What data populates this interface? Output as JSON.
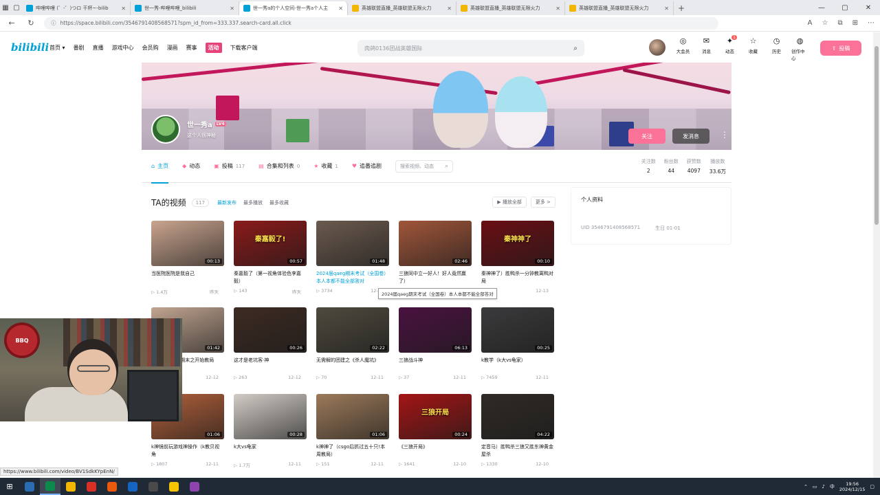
{
  "browser": {
    "tabs": [
      {
        "title": "哔哩哔哩 (゜-゜)つロ 干杯~-bilib",
        "color": "#00a1d6",
        "active": false
      },
      {
        "title": "世一秀-哔哩哔哩_bilibili",
        "color": "#00a1d6",
        "active": false
      },
      {
        "title": "世一秀a的个人空间-世一秀a个人主",
        "color": "#00a1d6",
        "active": true
      },
      {
        "title": "英雄联盟直播_英雄联盟无限火力",
        "color": "#f2b705",
        "active": false
      },
      {
        "title": "英雄联盟直播_英雄联盟无限火力",
        "color": "#f2b705",
        "active": false
      },
      {
        "title": "英雄联盟直播_英雄联盟无限火力",
        "color": "#f2b705",
        "active": false
      }
    ],
    "url": "https://space.bilibili.com/3546791408568571?spm_id_from=333.337.search-card.all.click",
    "status_url": "https://www.bilibili.com/video/BV1SdkKYpEnN/"
  },
  "header": {
    "logo": "bilibili",
    "nav": [
      "首页 ▾",
      "番剧",
      "直播",
      "游戏中心",
      "会员购",
      "漫画",
      "赛事",
      "活动",
      "下载客户端"
    ],
    "nav_highlight_index": 7,
    "search_placeholder": "肉鸽0136团战英雄国际",
    "icons": [
      {
        "label": "大会员",
        "icon": "◎"
      },
      {
        "label": "消息",
        "icon": "✉"
      },
      {
        "label": "动态",
        "icon": "✦",
        "badge": "1"
      },
      {
        "label": "收藏",
        "icon": "☆"
      },
      {
        "label": "历史",
        "icon": "◷"
      },
      {
        "label": "创作中心",
        "icon": "◍"
      }
    ],
    "upload_label": "投稿"
  },
  "profile": {
    "name": "世一秀a",
    "level": "LV4",
    "sign": "这个人很神秘",
    "follow_label": "关注",
    "message_label": "发消息"
  },
  "space_nav": {
    "items": [
      {
        "label": "主页",
        "icon": "⌂",
        "count": "",
        "active": true
      },
      {
        "label": "动态",
        "icon": "◆",
        "count": "",
        "active": false
      },
      {
        "label": "投稿",
        "icon": "▣",
        "count": "117",
        "active": false
      },
      {
        "label": "合集和列表",
        "icon": "▤",
        "count": "0",
        "active": false
      },
      {
        "label": "收藏",
        "icon": "★",
        "count": "1",
        "active": false
      },
      {
        "label": "追番追剧",
        "icon": "♥",
        "count": "",
        "active": false
      }
    ],
    "search_placeholder": "搜索视频、动态",
    "stats": [
      {
        "label": "关注数",
        "value": "2"
      },
      {
        "label": "粉丝数",
        "value": "44"
      },
      {
        "label": "获赞数",
        "value": "4097"
      },
      {
        "label": "播放数",
        "value": "33.6万"
      }
    ]
  },
  "videos_section": {
    "title": "TA的视频",
    "count": "117",
    "sorts": [
      {
        "label": "最新发布",
        "active": true
      },
      {
        "label": "最多播放",
        "active": false
      },
      {
        "label": "最多收藏",
        "active": false
      }
    ],
    "play_all": "▶ 播放全部",
    "more": "更多 >",
    "tooltip": "2024届qaeg期末考试（全国卷）本人本都不能全部答对",
    "videos": [
      {
        "title": "当医院医院是我自己",
        "duration": "00:13",
        "views": "1.4万",
        "date": "昨天",
        "thumb": "#c9a48e",
        "cap": "",
        "hover": false
      },
      {
        "title": "秦嘉毅了（第一视角体验色李嘉毅）",
        "duration": "00:57",
        "views": "143",
        "date": "昨天",
        "thumb": "#8a1a1a",
        "cap": "秦嘉毅了!",
        "hover": false
      },
      {
        "title": "2024届qaeg期末考试（全国卷）本人本都不能全部答对",
        "duration": "01:48",
        "views": "3734",
        "date": "12-17",
        "thumb": "#6b5a4e",
        "cap": "",
        "hover": true
      },
      {
        "title": "三狼同中立一好人！好人竟然赢了）",
        "duration": "02:46",
        "views": "",
        "date": "",
        "thumb": "#a0563a",
        "cap": "",
        "hover": false
      },
      {
        "title": "秦神神了）胜鸭杀一分钟教离鸭对局",
        "duration": "00:10",
        "views": "",
        "date": "12-13",
        "thumb": "#6a0f14",
        "cap": "秦神神了",
        "hover": false
      },
      {
        "title": "2024届qaeg期末之开始教局",
        "duration": "01:42",
        "views": "",
        "date": "12-12",
        "thumb": "#c1a591",
        "cap": "",
        "hover": false
      },
      {
        "title": "这才是老坑客·神",
        "duration": "00:26",
        "views": "263",
        "date": "12-12",
        "thumb": "#3d2b22",
        "cap": "",
        "hover": false
      },
      {
        "title": "无需解的团建之《杀人魔坑》",
        "duration": "02:22",
        "views": "70",
        "date": "12-11",
        "thumb": "#4e4a3e",
        "cap": "",
        "hover": false
      },
      {
        "title": "三狼战斗神",
        "duration": "06:13",
        "views": "37",
        "date": "12-11",
        "thumb": "#4a1240",
        "cap": "",
        "hover": false
      },
      {
        "title": "k教学（k大vs龟家）",
        "duration": "00:25",
        "views": "7459",
        "date": "12-11",
        "thumb": "#3b3a3c",
        "cap": "",
        "hover": false
      },
      {
        "title": "k神镜前玩游戏神操作（k教贝视角",
        "duration": "01:06",
        "views": "1807",
        "date": "12-11",
        "thumb": "#b2603a",
        "cap": "",
        "hover": false
      },
      {
        "title": "k大vs龟家",
        "duration": "00:28",
        "views": "1.7万",
        "date": "12-11",
        "thumb": "#d2ccc6",
        "cap": "",
        "hover": false
      },
      {
        "title": "k神神了（csgo后抓过五十只!本周教局）",
        "duration": "01:06",
        "views": "151",
        "date": "12-11",
        "thumb": "#9c7a5a",
        "cap": "",
        "hover": false
      },
      {
        "title": "《三狼开局》",
        "duration": "00:24",
        "views": "1641",
        "date": "12-10",
        "thumb": "#a31515",
        "cap": "三狼开局",
        "hover": false
      },
      {
        "title": "定音马）胜鸭杀三狼又胜东神黄金屋杀",
        "duration": "04:22",
        "views": "1330",
        "date": "12-10",
        "thumb": "#2f2a25",
        "cap": "",
        "hover": false
      }
    ]
  },
  "side": {
    "title": "个人资料",
    "uid_label": "UID",
    "uid": "3546791408568571",
    "birthday_label": "生日",
    "birthday": "01-01"
  },
  "overlay": {
    "cam_logo": "BBQ"
  },
  "taskbar": {
    "apps": [
      "#2b6cb0",
      "#0b8a4b",
      "#f2b705",
      "#d93025",
      "#e8590c",
      "#1565c0",
      "#4a4a4a",
      "#f8c300",
      "#8e44ad"
    ],
    "active_index": 1,
    "time": "19:56",
    "date": "2024/12/15",
    "ime": "中"
  }
}
